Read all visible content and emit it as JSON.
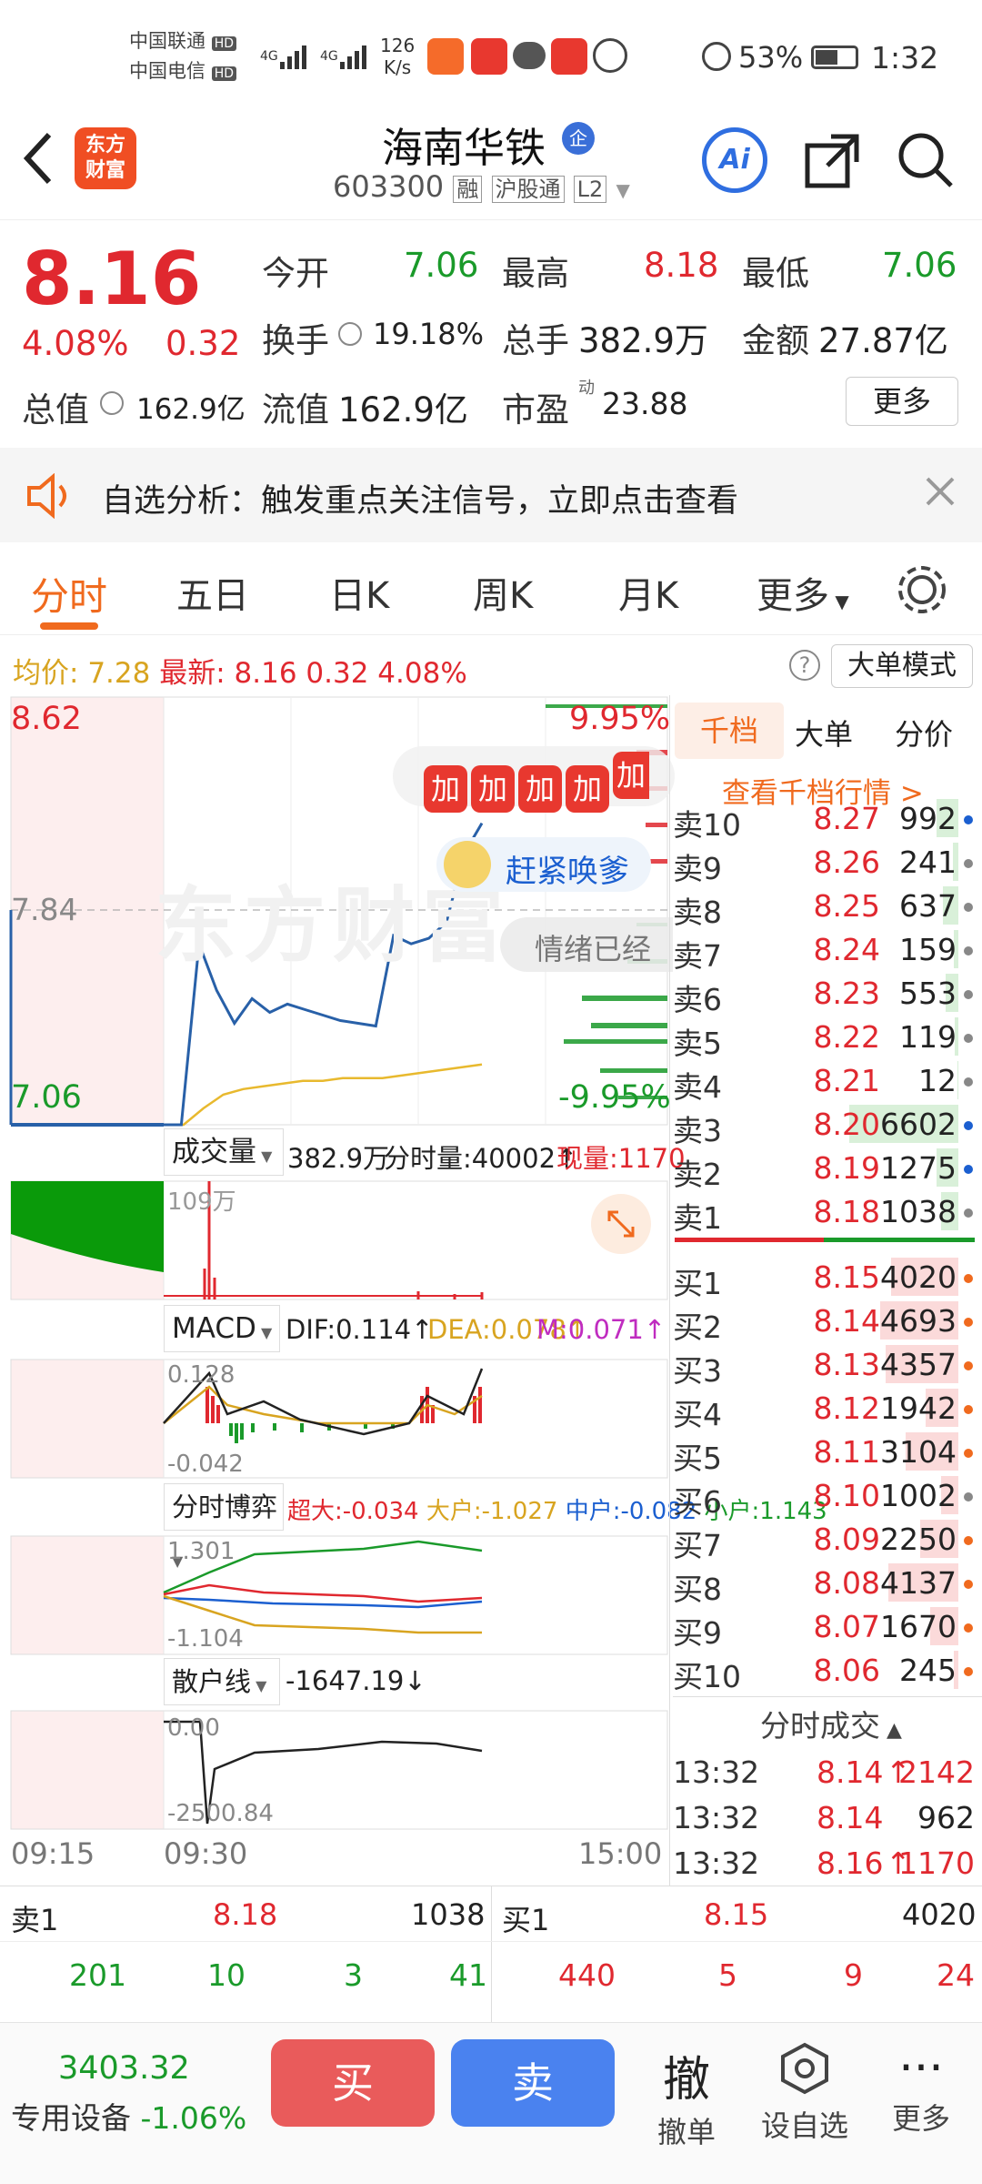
{
  "status_bar": {
    "carrier1": "中国联通",
    "carrier2": "中国电信",
    "hd": "HD",
    "net": "4G",
    "speed_value": "126",
    "speed_unit": "K/s",
    "battery": "53%",
    "time": "1:32"
  },
  "header": {
    "logo_line1": "东方",
    "logo_line2": "财富",
    "stock_name": "海南华铁",
    "corp_badge": "企",
    "code": "603300",
    "tag1": "融",
    "tag2": "沪股通",
    "tag3": "L2",
    "ai_label": "Ai"
  },
  "quote": {
    "price": "8.16",
    "change_pct": "4.08%",
    "change": "0.32",
    "open_label": "今开",
    "open": "7.06",
    "high_label": "最高",
    "high": "8.18",
    "low_label": "最低",
    "low": "7.06",
    "turnover_label": "换手",
    "turnover": "19.18%",
    "volume_label": "总手",
    "volume": "382.9万",
    "amount_label": "金额",
    "amount": "27.87亿",
    "mktcap_label": "总值",
    "mktcap": "162.9亿",
    "float_label": "流值",
    "float": "162.9亿",
    "pe_label": "市盈",
    "pe_sup": "动",
    "pe": "23.88",
    "more_label": "更多"
  },
  "banner": {
    "text": "自选分析：触发重点关注信号，立即点击查看"
  },
  "tabs": {
    "items": [
      "分时",
      "五日",
      "日K",
      "周K",
      "月K",
      "更多"
    ],
    "active": "分时"
  },
  "info_line": {
    "avg_label": "均价:",
    "avg": "7.28",
    "latest_label": "最新:",
    "latest": "8.16",
    "change": "0.32",
    "change_pct": "4.08%",
    "mode_button": "大单模式"
  },
  "chart_labels": {
    "price_top": "8.62",
    "price_mid": "7.84",
    "price_bottom": "7.06",
    "pct_top": "9.95%",
    "pct_bottom": "-9.95%",
    "watermark": "东方财富",
    "promo_add": "加",
    "promo_text": "赶紧唤爹",
    "promo_text2": "情绪已经",
    "vol_label": "成交量",
    "vol_total": "382.9万",
    "vol_min": "分时量:40002↑",
    "vol_now": "现量:1170",
    "vol_axis": "109万",
    "macd_label": "MACD",
    "dif": "DIF:0.114↑",
    "dea": "DEA:0.078↑",
    "m": "M:0.071↑",
    "macd_top": "0.128",
    "macd_bottom": "-0.042",
    "game_label": "分时博弈",
    "g_super": "超大:-0.034",
    "g_big": "大户:-1.027",
    "g_mid": "中户:-0.082",
    "g_small": "小户:1.143",
    "game_top": "1.301",
    "game_bottom": "-1.104",
    "retail_label": "散户线",
    "retail_value": "-1647.19↓",
    "retail_top": "0.00",
    "retail_bottom": "-2500.84",
    "time_start": "09:15",
    "time_open": "09:30",
    "time_end": "15:00"
  },
  "chart_data": {
    "type": "line",
    "x_range": [
      "09:15",
      "15:00"
    ],
    "ylim": [
      7.06,
      8.62
    ],
    "series": [
      {
        "values": [
          7.06,
          7.06,
          7.72,
          7.55,
          7.43,
          7.52,
          7.47,
          7.5,
          7.48,
          7.46,
          7.44,
          7.43,
          7.42,
          7.75,
          7.72,
          7.74,
          7.8,
          8.05,
          8.16
        ]
      },
      {
        "values": [
          7.06,
          7.06,
          7.12,
          7.17,
          7.19,
          7.2,
          7.21,
          7.22,
          7.22,
          7.23,
          7.23,
          7.23,
          7.24,
          7.25,
          7.26,
          7.27,
          7.28
        ]
      }
    ]
  },
  "order_book": {
    "tabs": [
      "千档",
      "大单",
      "分价"
    ],
    "link": "查看千档行情 >",
    "sell": [
      {
        "side": "卖10",
        "price": "8.27",
        "vol": "992"
      },
      {
        "side": "卖9",
        "price": "8.26",
        "vol": "241"
      },
      {
        "side": "卖8",
        "price": "8.25",
        "vol": "637"
      },
      {
        "side": "卖7",
        "price": "8.24",
        "vol": "159"
      },
      {
        "side": "卖6",
        "price": "8.23",
        "vol": "553"
      },
      {
        "side": "卖5",
        "price": "8.22",
        "vol": "119"
      },
      {
        "side": "卖4",
        "price": "8.21",
        "vol": "12"
      },
      {
        "side": "卖3",
        "price": "8.20",
        "vol": "6602"
      },
      {
        "side": "卖2",
        "price": "8.19",
        "vol": "1275"
      },
      {
        "side": "卖1",
        "price": "8.18",
        "vol": "1038"
      }
    ],
    "buy": [
      {
        "side": "买1",
        "price": "8.15",
        "vol": "4020"
      },
      {
        "side": "买2",
        "price": "8.14",
        "vol": "4693"
      },
      {
        "side": "买3",
        "price": "8.13",
        "vol": "4357"
      },
      {
        "side": "买4",
        "price": "8.12",
        "vol": "1942"
      },
      {
        "side": "买5",
        "price": "8.11",
        "vol": "3104"
      },
      {
        "side": "买6",
        "price": "8.10",
        "vol": "1002"
      },
      {
        "side": "买7",
        "price": "8.09",
        "vol": "2250"
      },
      {
        "side": "买8",
        "price": "8.08",
        "vol": "4137"
      },
      {
        "side": "买9",
        "price": "8.07",
        "vol": "1670"
      },
      {
        "side": "买10",
        "price": "8.06",
        "vol": "245"
      }
    ],
    "trades_title": "分时成交",
    "trades": [
      {
        "time": "13:32",
        "price": "8.14",
        "arrow": "↑",
        "vol": "2142"
      },
      {
        "time": "13:32",
        "price": "8.14",
        "arrow": "",
        "vol": "962"
      },
      {
        "time": "13:32",
        "price": "8.16",
        "arrow": "↑",
        "vol": "1170"
      }
    ]
  },
  "level_summary": {
    "sell_label": "卖1",
    "sell_price": "8.18",
    "sell_vol": "1038",
    "buy_label": "买1",
    "buy_price": "8.15",
    "buy_vol": "4020",
    "sell_details": [
      "201",
      "10",
      "3",
      "41"
    ],
    "buy_details": [
      "440",
      "5",
      "9",
      "24"
    ]
  },
  "bottom_bar": {
    "index_value": "3403.32",
    "index_label": "专用设备",
    "index_change": "-1.06%",
    "buy": "买",
    "sell": "卖",
    "cancel_icon": "撤",
    "cancel": "撤单",
    "watch": "设自选",
    "more": "更多"
  }
}
